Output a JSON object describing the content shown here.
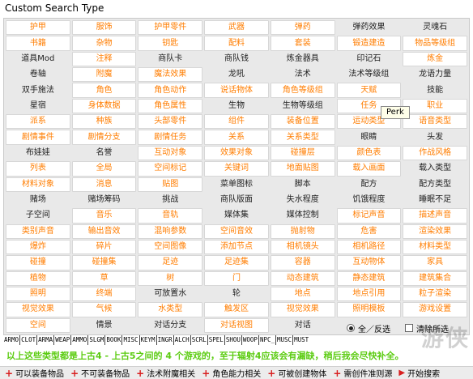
{
  "window": {
    "title": "Custom Search Type"
  },
  "grid": {
    "rows": [
      [
        {
          "t": "护甲",
          "s": "on"
        },
        {
          "t": "服饰",
          "s": "on"
        },
        {
          "t": "护甲零件",
          "s": "on"
        },
        {
          "t": "武器",
          "s": "on"
        },
        {
          "t": "弹药",
          "s": "on"
        },
        {
          "t": "弹药效果",
          "s": "off"
        },
        {
          "t": "灵魂石",
          "s": "off"
        }
      ],
      [
        {
          "t": "书籍",
          "s": "on"
        },
        {
          "t": "杂物",
          "s": "on"
        },
        {
          "t": "钥匙",
          "s": "on"
        },
        {
          "t": "配料",
          "s": "on"
        },
        {
          "t": "套装",
          "s": "on"
        },
        {
          "t": "锻造建造",
          "s": "on"
        },
        {
          "t": "物品等级组",
          "s": "on"
        }
      ],
      [
        {
          "t": "道具Mod",
          "s": "off"
        },
        {
          "t": "注释",
          "s": "on"
        },
        {
          "t": "商队卡",
          "s": "off"
        },
        {
          "t": "商队钱",
          "s": "off"
        },
        {
          "t": "炼金器具",
          "s": "off"
        },
        {
          "t": "印记石",
          "s": "off"
        },
        {
          "t": "炼金",
          "s": "on"
        }
      ],
      [
        {
          "t": "卷轴",
          "s": "off"
        },
        {
          "t": "附魔",
          "s": "on"
        },
        {
          "t": "魔法效果",
          "s": "on"
        },
        {
          "t": "龙吼",
          "s": "off"
        },
        {
          "t": "法术",
          "s": "off"
        },
        {
          "t": "法术等级组",
          "s": "off"
        },
        {
          "t": "龙语力量",
          "s": "off"
        }
      ],
      [
        {
          "t": "双手施法",
          "s": "off"
        },
        {
          "t": "角色",
          "s": "on"
        },
        {
          "t": "角色动作",
          "s": "on"
        },
        {
          "t": "说话物体",
          "s": "on"
        },
        {
          "t": "角色等级组",
          "s": "on"
        },
        {
          "t": "天赋",
          "s": "on"
        },
        {
          "t": "技能",
          "s": "off"
        }
      ],
      [
        {
          "t": "星宿",
          "s": "off"
        },
        {
          "t": "身体数据",
          "s": "on"
        },
        {
          "t": "角色属性",
          "s": "on"
        },
        {
          "t": "生物",
          "s": "off"
        },
        {
          "t": "生物等级组",
          "s": "off"
        },
        {
          "t": "任务",
          "s": "on"
        },
        {
          "t": "职业",
          "s": "on"
        }
      ],
      [
        {
          "t": "派系",
          "s": "on"
        },
        {
          "t": "种族",
          "s": "on"
        },
        {
          "t": "头部零件",
          "s": "on"
        },
        {
          "t": "组件",
          "s": "on"
        },
        {
          "t": "装备位置",
          "s": "on"
        },
        {
          "t": "运动类型",
          "s": "on"
        },
        {
          "t": "语音类型",
          "s": "on"
        }
      ],
      [
        {
          "t": "剧情事件",
          "s": "on"
        },
        {
          "t": "剧情分支",
          "s": "on"
        },
        {
          "t": "剧情任务",
          "s": "on"
        },
        {
          "t": "关系",
          "s": "on"
        },
        {
          "t": "关系类型",
          "s": "on"
        },
        {
          "t": "眼睛",
          "s": "off"
        },
        {
          "t": "头发",
          "s": "off"
        }
      ],
      [
        {
          "t": "布娃娃",
          "s": "off"
        },
        {
          "t": "名誉",
          "s": "off"
        },
        {
          "t": "互动对象",
          "s": "on"
        },
        {
          "t": "效果对象",
          "s": "on"
        },
        {
          "t": "碰撞层",
          "s": "on"
        },
        {
          "t": "颜色表",
          "s": "on"
        },
        {
          "t": "作战风格",
          "s": "on"
        }
      ],
      [
        {
          "t": "列表",
          "s": "on"
        },
        {
          "t": "全局",
          "s": "on"
        },
        {
          "t": "空间标记",
          "s": "on"
        },
        {
          "t": "关键词",
          "s": "on"
        },
        {
          "t": "地面贴图",
          "s": "on"
        },
        {
          "t": "载入画面",
          "s": "on"
        },
        {
          "t": "载入类型",
          "s": "off"
        }
      ],
      [
        {
          "t": "材料对象",
          "s": "on"
        },
        {
          "t": "消息",
          "s": "on"
        },
        {
          "t": "贴图",
          "s": "on"
        },
        {
          "t": "菜单图标",
          "s": "off"
        },
        {
          "t": "脚本",
          "s": "off"
        },
        {
          "t": "配方",
          "s": "off"
        },
        {
          "t": "配方类型",
          "s": "off"
        }
      ],
      [
        {
          "t": "赌场",
          "s": "off"
        },
        {
          "t": "赌场筹码",
          "s": "off"
        },
        {
          "t": "挑战",
          "s": "off"
        },
        {
          "t": "商队版面",
          "s": "off"
        },
        {
          "t": "失水程度",
          "s": "off"
        },
        {
          "t": "饥饿程度",
          "s": "off"
        },
        {
          "t": "睡眠不足",
          "s": "off"
        }
      ],
      [
        {
          "t": "子空间",
          "s": "off"
        },
        {
          "t": "音乐",
          "s": "on"
        },
        {
          "t": "音轨",
          "s": "on"
        },
        {
          "t": "媒体集",
          "s": "off"
        },
        {
          "t": "媒体控制",
          "s": "off"
        },
        {
          "t": "标记声音",
          "s": "on"
        },
        {
          "t": "描述声音",
          "s": "on"
        }
      ],
      [
        {
          "t": "类别声音",
          "s": "on"
        },
        {
          "t": "输出音效",
          "s": "on"
        },
        {
          "t": "混响参数",
          "s": "on"
        },
        {
          "t": "空间音效",
          "s": "on"
        },
        {
          "t": "抛射物",
          "s": "on"
        },
        {
          "t": "危害",
          "s": "on"
        },
        {
          "t": "渲染效果",
          "s": "on"
        }
      ],
      [
        {
          "t": "爆炸",
          "s": "on"
        },
        {
          "t": "碎片",
          "s": "on"
        },
        {
          "t": "空间图像",
          "s": "on"
        },
        {
          "t": "添加节点",
          "s": "on"
        },
        {
          "t": "相机镜头",
          "s": "on"
        },
        {
          "t": "相机路径",
          "s": "on"
        },
        {
          "t": "材料类型",
          "s": "on"
        }
      ],
      [
        {
          "t": "碰撞",
          "s": "on"
        },
        {
          "t": "碰撞集",
          "s": "on"
        },
        {
          "t": "足迹",
          "s": "on"
        },
        {
          "t": "足迹集",
          "s": "on"
        },
        {
          "t": "容器",
          "s": "on"
        },
        {
          "t": "互动物体",
          "s": "on"
        },
        {
          "t": "家具",
          "s": "on"
        }
      ],
      [
        {
          "t": "植物",
          "s": "on"
        },
        {
          "t": "草",
          "s": "on"
        },
        {
          "t": "树",
          "s": "on"
        },
        {
          "t": "门",
          "s": "on"
        },
        {
          "t": "动态建筑",
          "s": "on"
        },
        {
          "t": "静态建筑",
          "s": "on"
        },
        {
          "t": "建筑集合",
          "s": "on"
        }
      ],
      [
        {
          "t": "照明",
          "s": "on"
        },
        {
          "t": "终端",
          "s": "on"
        },
        {
          "t": "可放置水",
          "s": "off"
        },
        {
          "t": "轮",
          "s": "off"
        },
        {
          "t": "地点",
          "s": "on"
        },
        {
          "t": "地点引用",
          "s": "on"
        },
        {
          "t": "粒子渲染",
          "s": "on"
        }
      ],
      [
        {
          "t": "视觉效果",
          "s": "on"
        },
        {
          "t": "气候",
          "s": "on"
        },
        {
          "t": "水类型",
          "s": "on"
        },
        {
          "t": "触发区",
          "s": "on"
        },
        {
          "t": "视觉效果",
          "s": "on"
        },
        {
          "t": "照明模板",
          "s": "on"
        },
        {
          "t": "游戏设置",
          "s": "on"
        }
      ],
      [
        {
          "t": "空间",
          "s": "on"
        },
        {
          "t": "情景",
          "s": "off"
        },
        {
          "t": "对话分支",
          "s": "off"
        },
        {
          "t": "对话视图",
          "s": "on"
        },
        {
          "t": "对话",
          "s": "off"
        },
        {
          "t": "",
          "s": "off"
        },
        {
          "t": "",
          "s": "off"
        }
      ]
    ]
  },
  "tooltip": {
    "text": "Perk"
  },
  "abbreviations": [
    "ARMO",
    "CLOT",
    "ARMA",
    "WEAP",
    "AMMO",
    "SLGM",
    "BOOK",
    "MISC",
    "KEYM",
    "INGR",
    "ALCH",
    "SCRL",
    "SPEL",
    "SHOU",
    "WOOP",
    "NPC_",
    "MUSC",
    "MUST"
  ],
  "controls": {
    "all_invert_label": "全／反选",
    "clear_label": "清除所选"
  },
  "notice": "以上这些类型都是上古4 - 上古5之间的 4 个游戏的，至于辐射4应该会有漏缺，稍后我会尽快补全。",
  "bottom_bar": {
    "items": [
      {
        "label": "可以装备物品"
      },
      {
        "label": "不可装备物品"
      },
      {
        "label": "法术附魔相关"
      },
      {
        "label": "角色能力相关"
      },
      {
        "label": "可被创建物体"
      },
      {
        "label": "需创件准则源"
      }
    ],
    "start_search_label": "开始搜索"
  },
  "watermark": "游侠",
  "colors": {
    "accent": "#ff7d00",
    "notice": "#5ccc12",
    "off_bg": "#e9e9e9",
    "on_bg": "#ffffff"
  }
}
